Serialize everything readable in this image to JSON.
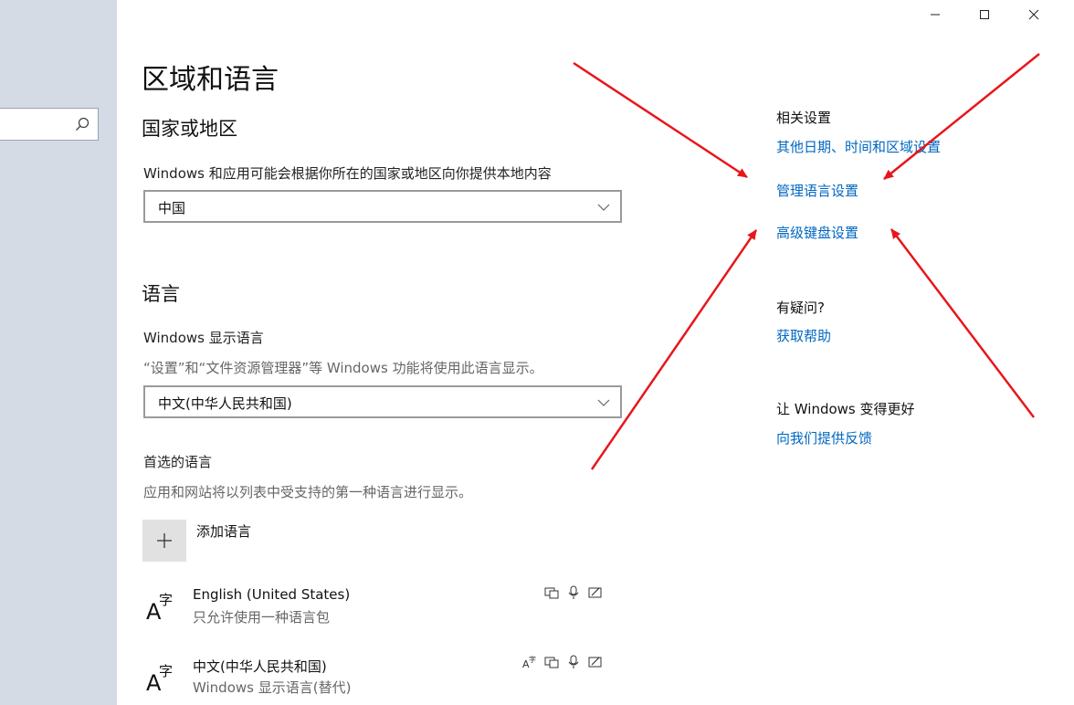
{
  "window": {
    "minimize_glyph": "—",
    "maximize_glyph": "☐",
    "close_glyph": "✕"
  },
  "page": {
    "title": "区域和语言"
  },
  "region": {
    "title": "国家或地区",
    "description": "Windows 和应用可能会根据你所在的国家或地区向你提供本地内容",
    "selected": "中国"
  },
  "language": {
    "title": "语言",
    "display_label": "Windows 显示语言",
    "display_description": "“设置”和“文件资源管理器”等 Windows 功能将使用此语言显示。",
    "display_selected": "中文(中华人民共和国)",
    "preferred_label": "首选的语言",
    "preferred_description": "应用和网站将以列表中受支持的第一种语言进行显示。",
    "add_label": "添加语言",
    "items": [
      {
        "name": "English (United States)",
        "subtitle": "只允许使用一种语言包"
      },
      {
        "name": "中文(中华人民共和国)",
        "subtitle": "Windows 显示语言(替代)"
      }
    ]
  },
  "related": {
    "heading": "相关设置",
    "links": [
      "其他日期、时间和区域设置",
      "管理语言设置",
      "高级键盘设置"
    ]
  },
  "help": {
    "heading": "有疑问?",
    "link": "获取帮助"
  },
  "feedback": {
    "heading": "让 Windows 变得更好",
    "link": "向我们提供反馈"
  },
  "icons": {
    "search": "search-icon",
    "chevron": "chevron-down-icon",
    "plus": "plus-icon",
    "language": "language-glyph-icon",
    "display": "display-language-icon",
    "speech": "speech-icon",
    "handwriting": "handwriting-icon",
    "text": "text-input-icon"
  },
  "colors": {
    "link": "#0067c0",
    "sidebar": "#d4dbe4",
    "annotation_arrow": "#e8161b"
  }
}
